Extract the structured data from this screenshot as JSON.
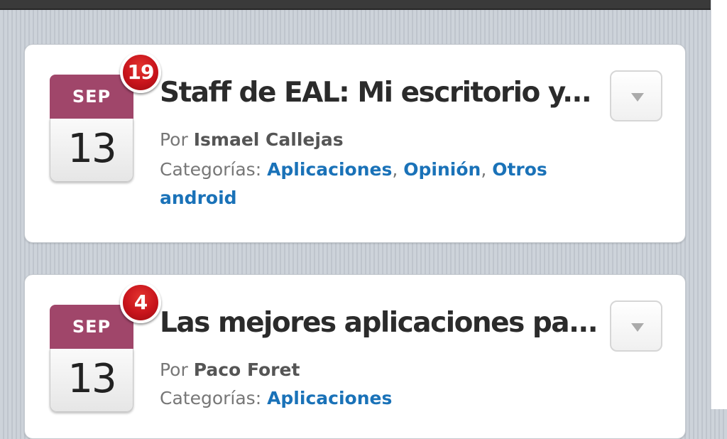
{
  "posts": [
    {
      "month": "SEP",
      "day": "13",
      "comments": "19",
      "title": "Staff de EAL: Mi escritorio y...",
      "author_prefix": "Por ",
      "author": "Ismael Callejas",
      "categories_label": "Categorías: ",
      "categories": [
        "Aplicaciones",
        "Opinión",
        "Otros android"
      ],
      "separator": ", "
    },
    {
      "month": "SEP",
      "day": "13",
      "comments": "4",
      "title": "Las mejores aplicaciones pa...",
      "author_prefix": "Por ",
      "author": "Paco Foret",
      "categories_label": "Categorías: ",
      "categories": [
        "Aplicaciones"
      ]
    }
  ],
  "icons": {
    "dropdown": "chevron-down-icon",
    "comments": "comment-count-badge"
  },
  "colors": {
    "calendar_month_bg": "#a0466a",
    "badge_red": "#c8141c",
    "link_blue": "#1a72b8",
    "title_text": "#2b2b2b",
    "background_stripes": "#c9cfd6"
  }
}
